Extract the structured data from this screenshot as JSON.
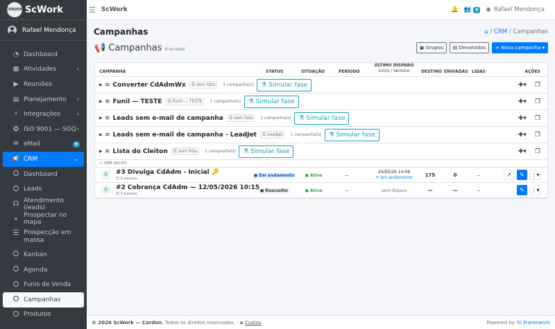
{
  "brand": {
    "logo": "CORDON",
    "name": "ScWork"
  },
  "user": {
    "name": "Rafael Mendonça"
  },
  "sidebar": {
    "items": [
      {
        "label": "Dashboard",
        "icon": "tachometer-icon"
      },
      {
        "label": "Atividades",
        "icon": "calendar-icon"
      },
      {
        "label": "Reuniões",
        "icon": "video-icon"
      },
      {
        "label": "Planejamento",
        "icon": "clipboard-icon"
      },
      {
        "label": "Integrações",
        "icon": "plug-icon"
      },
      {
        "label": "ISO 9001 — SGQ",
        "icon": "certificate-icon"
      },
      {
        "label": "eMail",
        "icon": "envelope-icon",
        "badge": "9"
      },
      {
        "label": "CRM",
        "icon": "bullhorn-icon"
      }
    ],
    "crm_sub": [
      "Dashboard",
      "Leads",
      "Atendimento (leads)",
      "Prospectar no mapa",
      "Prospecção em massa",
      "Kanban",
      "Agenda",
      "Funis de Venda",
      "Campanhas",
      "Produtos"
    ]
  },
  "topbar": {
    "title": "ScWork",
    "badge": "9",
    "user": "Rafael Mendonça"
  },
  "page": {
    "title": "Campanhas",
    "breadcrumb": {
      "crm": "CRM",
      "sep": "/",
      "current": "Campanhas"
    }
  },
  "card": {
    "title": "Campanhas",
    "subtitle": "9 no total",
    "btn_grupos": "Grupos",
    "btn_devolvidos": "Devolvidos",
    "btn_nova": "+ Nova campanha ▾"
  },
  "table": {
    "headers": {
      "campanha": "CAMPANHA",
      "status": "STATUS",
      "situacao": "SITUAÇÃO",
      "periodo": "PERÍODO",
      "ultimo": "ÚLTIMO DISPARO",
      "ultimo_sub": "início / término",
      "destino": "DESTINO",
      "enviadas": "ENVIADAS",
      "lidas": "LIDAS",
      "acoes": "AÇÕES"
    },
    "funnel_rows": [
      {
        "name": "Converter CdAdmWx",
        "chip": "sem lista",
        "count": "3 campanha(s)",
        "action": "Simular fase"
      },
      {
        "name": "Funil — TESTE",
        "chip": "Funil — TESTE",
        "count": "1 campanha(s)",
        "action": "Simular fase"
      },
      {
        "name": "Leads sem e-mail de campanha",
        "chip": "sem lista",
        "count": "1 campanha(s)",
        "action": "Simular fase"
      },
      {
        "name": "Leads sem e-mail de campanha - LeadJet",
        "chip": "LeadJet",
        "count": "1 campanha(s)",
        "action": "Simular fase"
      },
      {
        "name": "Lista do Cleiton",
        "chip": "sem lista",
        "count": "1 campanha(s)",
        "action": "Simular fase"
      }
    ],
    "group_label": "SEM GRUPO",
    "campaigns": [
      {
        "name": "#3 Divulga CdAdm - Inicial 🔑",
        "steps": "5 passos",
        "status": "Em andamento",
        "situacao": "Ativa",
        "periodo": "—",
        "ultimo": "20/05/26 14:06",
        "ultimo_sub": "em andamento",
        "destino": "175",
        "enviadas": "0",
        "lidas": "—"
      },
      {
        "name": "#2 Cobrança CdAdm — 12/05/2026 10:15",
        "steps": "0 passos",
        "status": "Rascunho",
        "situacao": "Ativa",
        "periodo": "—",
        "ultimo": "sem disparo",
        "ultimo_sub": "",
        "destino": "—",
        "enviadas": "—",
        "lidas": "—"
      }
    ]
  },
  "footer": {
    "copyright": "© 2026 ScWork — Cordon.",
    "rights": "Todos os direitos reservados.",
    "custos": "Custos",
    "powered": "Powered by",
    "framework": "Yii Framework"
  }
}
